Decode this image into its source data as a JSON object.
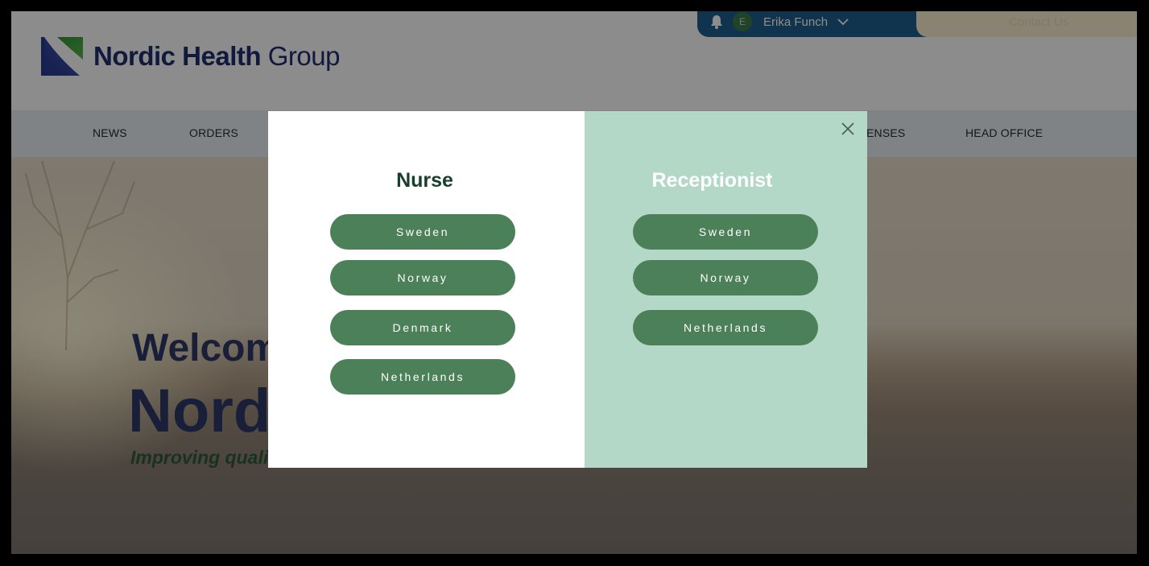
{
  "brand": {
    "name_bold": "Nordic Health",
    "name_light": "Group",
    "colors": {
      "navy": "#1f2f6e",
      "green": "#3c9a3c"
    }
  },
  "userbar": {
    "avatar_initial": "E",
    "user_name": "Erika Funch",
    "contact_label": "Contact Us"
  },
  "nav": {
    "items": [
      "NEWS",
      "ORDERS",
      "ENSES",
      "HEAD OFFICE"
    ]
  },
  "hero": {
    "title_line1": "Welcom",
    "title_line2": "Nord",
    "subtitle": "Improving quali"
  },
  "modal": {
    "accent_color": "#4b8058",
    "right_panel_color": "#b3d8c7",
    "left": {
      "title": "Nurse",
      "buttons": [
        "Sweden",
        "Norway",
        "Denmark",
        "Netherlands"
      ]
    },
    "right": {
      "title": "Receptionist",
      "buttons": [
        "Sweden",
        "Norway",
        "Netherlands"
      ]
    },
    "close_icon": "close-icon"
  }
}
